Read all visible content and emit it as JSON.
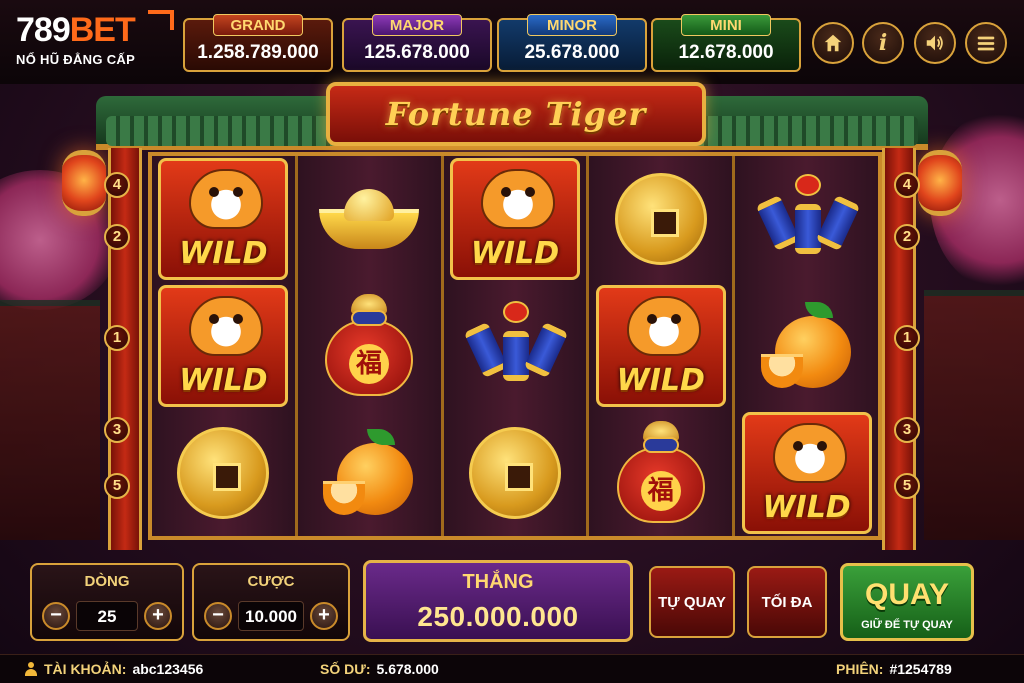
{
  "brand": {
    "logo_number": "789",
    "logo_brand": "BET",
    "tagline": "NỔ HŨ ĐẲNG CẤP"
  },
  "jackpots": [
    {
      "label": "GRAND",
      "value": "1.258.789.000"
    },
    {
      "label": "MAJOR",
      "value": "125.678.000"
    },
    {
      "label": "MINOR",
      "value": "25.678.000"
    },
    {
      "label": "MINI",
      "value": "12.678.000"
    }
  ],
  "top_buttons": {
    "home_icon": "home-icon",
    "info_icon": "info-icon",
    "sound_icon": "speaker-icon",
    "menu_icon": "menu-icon",
    "info_glyph": "i"
  },
  "game": {
    "title": "Fortune Tiger",
    "wild_label": "WILD",
    "bag_glyph": "福"
  },
  "paylines": {
    "left": [
      "4",
      "2",
      "1",
      "3",
      "5"
    ],
    "right": [
      "4",
      "2",
      "1",
      "3",
      "5"
    ]
  },
  "reels": [
    [
      "wild",
      "wild",
      "coin"
    ],
    [
      "ingot",
      "bag",
      "orange"
    ],
    [
      "wild",
      "crackers",
      "coin"
    ],
    [
      "coin",
      "wild",
      "bag"
    ],
    [
      "crackers",
      "orange",
      "wild"
    ]
  ],
  "controls": {
    "lines_label": "DÒNG",
    "lines_value": "25",
    "bet_label": "CƯỢC",
    "bet_value": "10.000",
    "minus": "−",
    "plus": "+",
    "win_label": "THẮNG",
    "win_value": "250.000.000",
    "autospin_label": "TỰ QUAY",
    "maxbet_label": "TỐI ĐA",
    "spin_label": "QUAY",
    "spin_hint": "GIỮ ĐỂ TỰ QUAY"
  },
  "status": {
    "account_label": "TÀI KHOẢN:",
    "account_value": "abc123456",
    "balance_label": "SỐ DƯ:",
    "balance_value": "5.678.000",
    "session_label": "PHIÊN:",
    "session_value": "#1254789"
  },
  "colors": {
    "accent_gold": "#d9a23b",
    "brand_orange": "#ff6a1a",
    "grand": "#c4451f",
    "major": "#8e3ab8",
    "minor": "#2a6ac8",
    "mini": "#3a9a3a",
    "spin_green": "#3aa03a"
  }
}
